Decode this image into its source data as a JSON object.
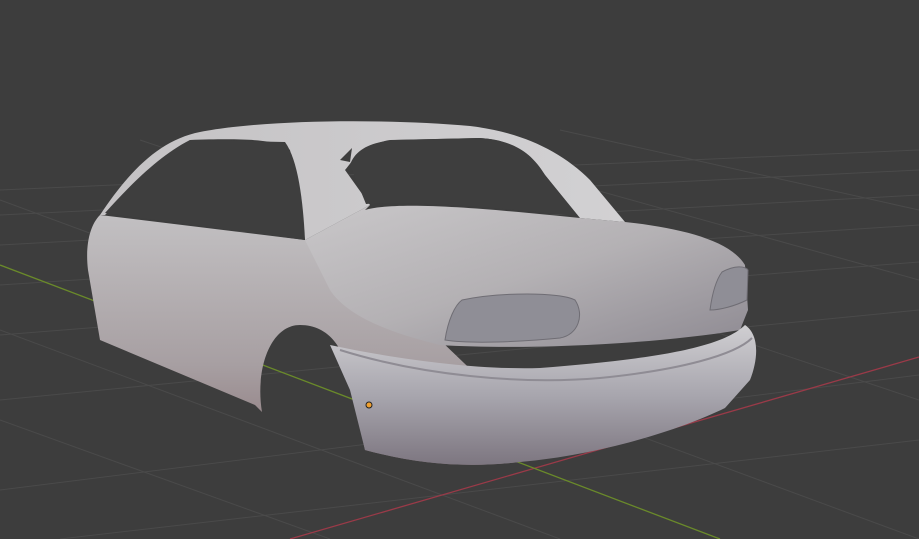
{
  "viewport": {
    "background_color": "#3d3d3d",
    "grid_color": "#4a4a4a",
    "x_axis_color": "#9a3a48",
    "y_axis_color": "#6a8a2a",
    "origin_point_color": "#f0a030"
  }
}
